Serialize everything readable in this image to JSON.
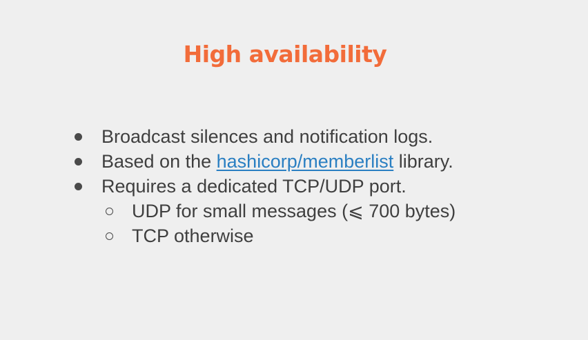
{
  "slide": {
    "title": "High availability",
    "colors": {
      "title": "#f26c3a",
      "text": "#3f3f3f",
      "link": "#2a7fc2",
      "background": "#efefef"
    },
    "bullets": [
      {
        "text": "Broadcast silences and notification logs."
      },
      {
        "pre": "Based on the ",
        "link": "hashicorp/memberlist",
        "post": " library."
      },
      {
        "text": "Requires a dedicated TCP/UDP port."
      }
    ],
    "sub_bullets": [
      {
        "text": "UDP for small messages (⩽ 700 bytes)"
      },
      {
        "text": "TCP otherwise"
      }
    ],
    "icons": {
      "bullet": "filled-circle-bullet-icon",
      "sub_bullet": "hollow-circle-bullet-icon"
    }
  }
}
